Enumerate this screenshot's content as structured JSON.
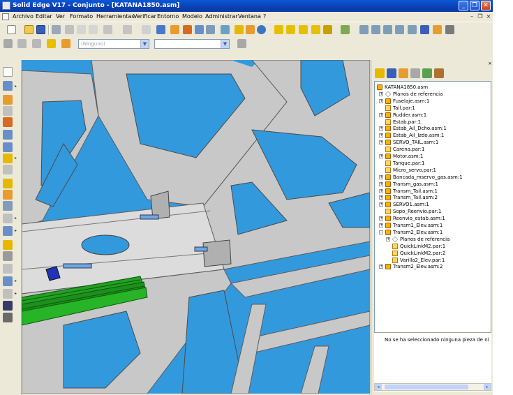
{
  "window": {
    "title": "Solid Edge V17 - Conjunto - [KATANA1850.asm]"
  },
  "colors": {
    "titlebar": "#0c3fb3",
    "viewport_bg": "#3399dd",
    "frame_gray": "#c8c8c8",
    "plate_light": "#dcdcdc",
    "green_part": "#22a022",
    "blue_part": "#2233bb",
    "asm_icon": "#f5b200"
  },
  "menu": [
    "Archivo",
    "Editar",
    "Ver",
    "Formato",
    "Herramientas",
    "Verificar",
    "Entorno",
    "Modelo",
    "Administrar",
    "Ventana",
    "?"
  ],
  "toolbar2": {
    "combo1_value": "(Ninguno)",
    "combo2_value": ""
  },
  "tree": {
    "items": [
      {
        "label": "KATANA1850.asm",
        "icon": "asm",
        "level": 0,
        "expander": ""
      },
      {
        "label": "Planos de referencia",
        "icon": "ref",
        "level": 1,
        "expander": "+"
      },
      {
        "label": "Fuselaje.asm:1",
        "icon": "asm",
        "level": 1,
        "expander": "+"
      },
      {
        "label": "Tail.par:1",
        "icon": "part",
        "level": 1,
        "expander": ""
      },
      {
        "label": "Rudder.asm:1",
        "icon": "asm",
        "level": 1,
        "expander": "+"
      },
      {
        "label": "Estab.par:1",
        "icon": "part",
        "level": 1,
        "expander": ""
      },
      {
        "label": "Estab_Ail_Dcho.asm:1",
        "icon": "asm",
        "level": 1,
        "expander": "+"
      },
      {
        "label": "Estab_Ail_Izdo.asm:1",
        "icon": "asm",
        "level": 1,
        "expander": "+"
      },
      {
        "label": "SERVO_TAIL.asm:1",
        "icon": "asm",
        "level": 1,
        "expander": "+"
      },
      {
        "label": "Carena.par:1",
        "icon": "part",
        "level": 1,
        "expander": ""
      },
      {
        "label": "Motor.asm:1",
        "icon": "asm",
        "level": 1,
        "expander": "+"
      },
      {
        "label": "Tanque.par:1",
        "icon": "part",
        "level": 1,
        "expander": ""
      },
      {
        "label": "Micro_servo.par:1",
        "icon": "part",
        "level": 1,
        "expander": ""
      },
      {
        "label": "Bancada_mservo_gas.asm:1",
        "icon": "asm",
        "level": 1,
        "expander": "+"
      },
      {
        "label": "Transm_gas.asm:1",
        "icon": "asm",
        "level": 1,
        "expander": "+"
      },
      {
        "label": "Transm_Tail.asm:1",
        "icon": "asm",
        "level": 1,
        "expander": "+"
      },
      {
        "label": "Transm_Tail.asm:2",
        "icon": "asm",
        "level": 1,
        "expander": "+"
      },
      {
        "label": "SERVO1.asm:1",
        "icon": "asm",
        "level": 1,
        "expander": "+"
      },
      {
        "label": "Sopo_Reenvio.par:1",
        "icon": "part",
        "level": 1,
        "expander": ""
      },
      {
        "label": "Reenvio_estab.asm:1",
        "icon": "asm",
        "level": 1,
        "expander": "+"
      },
      {
        "label": "Transm1_Elev.asm:1",
        "icon": "asm",
        "level": 1,
        "expander": "+"
      },
      {
        "label": "Transm2_Elev.asm:1",
        "icon": "asm",
        "level": 1,
        "expander": "-"
      },
      {
        "label": "Planos de referencia",
        "icon": "ref",
        "level": 2,
        "expander": "+"
      },
      {
        "label": "QuickLinkM2.par:1",
        "icon": "part",
        "level": 2,
        "expander": ""
      },
      {
        "label": "QuickLinkM2.par:2",
        "icon": "part",
        "level": 2,
        "expander": ""
      },
      {
        "label": "Varilla2_Elev.par:1",
        "icon": "part",
        "level": 2,
        "expander": ""
      },
      {
        "label": "Transm2_Elev.asm:2",
        "icon": "asm",
        "level": 1,
        "expander": "+"
      }
    ]
  },
  "info_text": "No se ha seleccionado ninguna pieza de nive"
}
